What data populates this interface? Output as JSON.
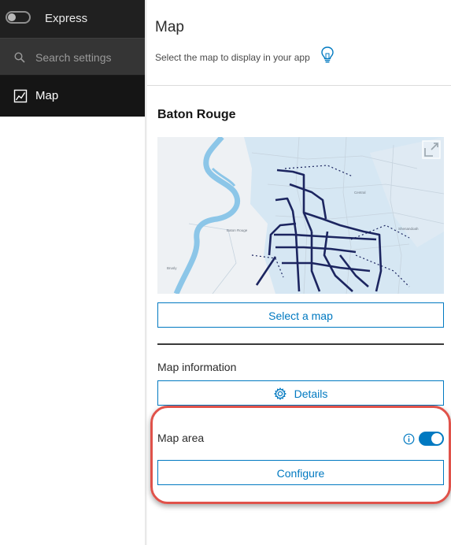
{
  "nav": {
    "express": {
      "label": "Express",
      "enabled": false
    },
    "search": {
      "placeholder": "Search settings",
      "icon": "search-icon"
    },
    "active_item": {
      "label": "Map",
      "icon": "map-icon"
    }
  },
  "header": {
    "title": "Map",
    "description": "Select the map to display in your app",
    "tip_icon": "lightbulb-icon"
  },
  "map": {
    "name": "Baton Rouge",
    "thumbnail_icon": "map-thumbnail",
    "expand_icon": "open-external-icon",
    "select_button": "Select a map"
  },
  "map_information": {
    "label": "Map information",
    "details_button": "Details",
    "details_icon": "gear-icon"
  },
  "map_area": {
    "label": "Map area",
    "info_icon": "info-icon",
    "enabled": true,
    "configure_button": "Configure"
  },
  "colors": {
    "accent": "#0079c1",
    "nav_background": "#2b2b2b",
    "highlight": "#e0524a",
    "river": "#8cc6e8",
    "route_lines": "#1c2560"
  }
}
